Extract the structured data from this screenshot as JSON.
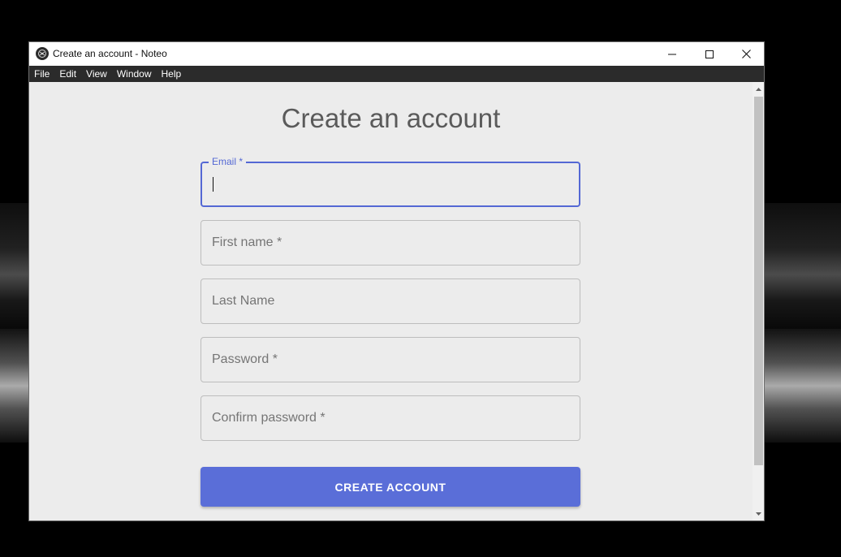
{
  "window": {
    "title": "Create an account - Noteo"
  },
  "menu": {
    "items": [
      "File",
      "Edit",
      "View",
      "Window",
      "Help"
    ]
  },
  "form": {
    "heading": "Create an account",
    "fields": [
      {
        "label": "Email *",
        "value": "",
        "focused": true
      },
      {
        "label": "First name *",
        "value": ""
      },
      {
        "label": "Last Name",
        "value": ""
      },
      {
        "label": "Password *",
        "value": ""
      },
      {
        "label": "Confirm password *",
        "value": ""
      }
    ],
    "submit_label": "CREATE ACCOUNT"
  },
  "colors": {
    "accent": "#5a6ed8",
    "focus": "#5468d4",
    "menubar": "#2b2b2b",
    "content_bg": "#ececec"
  },
  "icons": {
    "app": "noteo-app-icon",
    "minimize": "minimize-icon",
    "maximize": "maximize-icon",
    "close": "close-icon",
    "scroll_up": "arrow-up-icon",
    "scroll_down": "arrow-down-icon"
  }
}
